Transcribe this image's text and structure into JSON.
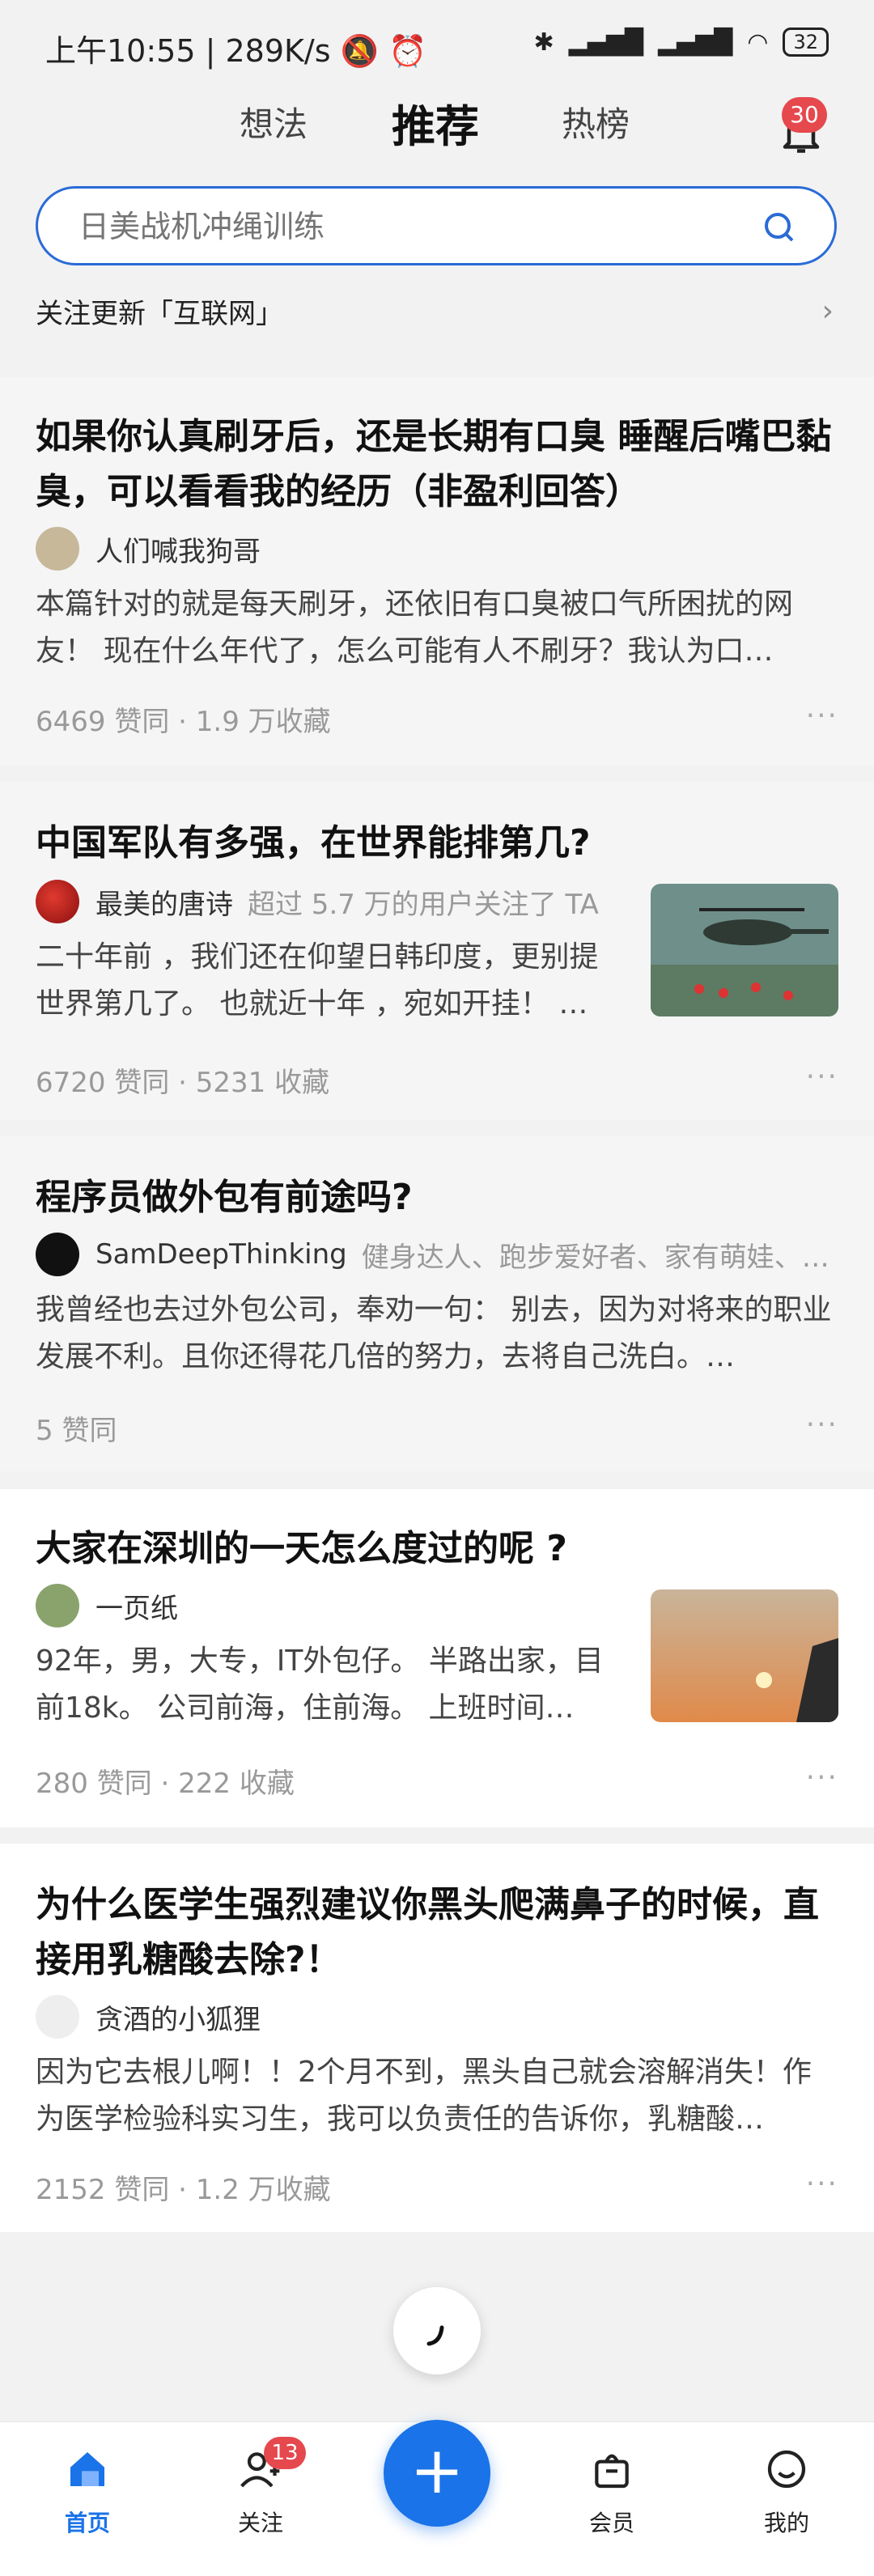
{
  "status_bar": {
    "time": "上午10:55",
    "speed": "289K/s",
    "battery": "32"
  },
  "tabs": [
    {
      "label": "想法"
    },
    {
      "label": "推荐"
    },
    {
      "label": "热榜"
    }
  ],
  "notifications": {
    "count": "30"
  },
  "search": {
    "placeholder": "日美战机冲绳训练"
  },
  "follow_update": "关注更新「互联网」",
  "feed": [
    {
      "title": "如果你认真刷牙后，还是长期有口臭 睡醒后嘴巴黏臭，可以看看我的经历（非盈利回答）",
      "author": "人们喊我狗哥",
      "meta": "",
      "excerpt": "本篇针对的就是每天刷牙，还依旧有口臭被口气所困扰的网友！ 现在什么年代了，怎么可能有人不刷牙？我认为口…",
      "stats": "6469 赞同 · 1.9 万收藏"
    },
    {
      "title": "中国军队有多强，在世界能排第几?",
      "author": "最美的唐诗",
      "meta": "超过 5.7 万的用户关注了 TA",
      "excerpt": "二十年前 ，我们还在仰望日韩印度，更别提世界第几了。 也就近十年 ，宛如开挂！ …",
      "stats": "6720 赞同 · 5231 收藏"
    },
    {
      "title": "程序员做外包有前途吗?",
      "author": "SamDeepThinking",
      "meta": "健身达人、跑步爱好者、家有萌娃、…",
      "excerpt": "我曾经也去过外包公司，奉劝一句： 别去，因为对将来的职业发展不利。且你还得花几倍的努力，去将自己洗白。…",
      "stats": "5 赞同"
    },
    {
      "title": "大家在深圳的一天怎么度过的呢 ?",
      "author": "一页纸",
      "meta": "",
      "excerpt": "92年，男，大专，IT外包仔。 半路出家，目前18k。 公司前海，住前海。 上班时间…",
      "stats": "280 赞同 · 222 收藏"
    },
    {
      "title": "为什么医学生强烈建议你黑头爬满鼻子的时候，直接用乳糖酸去除?！",
      "author": "贪酒的小狐狸",
      "meta": "",
      "excerpt": "因为它去根儿啊！！2个月不到，黑头自己就会溶解消失！作为医学检验科实习生，我可以负责任的告诉你，乳糖酸…",
      "stats": "2152 赞同 · 1.2 万收藏"
    }
  ],
  "more_label": "···",
  "bottom_nav": [
    {
      "label": "首页"
    },
    {
      "label": "关注",
      "badge": "13"
    },
    {
      "label": "会员"
    },
    {
      "label": "我的"
    }
  ],
  "colors": {
    "accent": "#1a73e8",
    "badge": "#e5484d"
  }
}
